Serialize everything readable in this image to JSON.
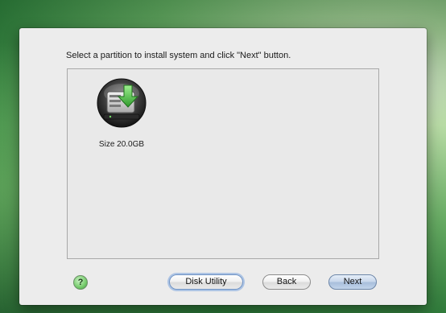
{
  "installer": {
    "instruction": "Select a partition to install system and click \"Next\" button.",
    "partitions": [
      {
        "size_label": "Size 20.0GB",
        "icon": "hard-disk-install-icon"
      }
    ],
    "buttons": {
      "help": "?",
      "disk_utility": "Disk Utility",
      "back": "Back",
      "next": "Next"
    }
  },
  "colors": {
    "panel_background": "#ececec",
    "list_background": "#e9e9e9",
    "install_arrow": "#4fc64a",
    "next_button": "#b9cce6"
  }
}
